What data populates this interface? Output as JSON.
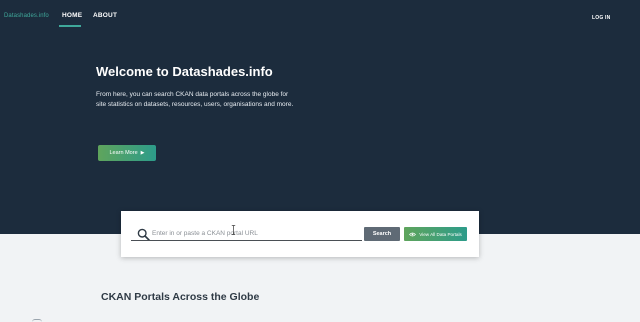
{
  "nav": {
    "logo": "Datashades.info",
    "home": "HOME",
    "about": "ABOUT",
    "login": "LOG IN"
  },
  "hero": {
    "title": "Welcome to Datashades.info",
    "description": "From here, you can search CKAN data portals across the globe for site statistics on datasets, resources, users, organisations and more.",
    "learn_more": "Learn More"
  },
  "search": {
    "placeholder": "Enter in or paste a CKAN portal URL",
    "search_label": "Search",
    "view_all_label": "View All Data Portals"
  },
  "section": {
    "title": "CKAN Portals Across the Globe"
  },
  "colors": {
    "hero_bg": "#1c2c3d",
    "accent": "#3fa89a",
    "button_green_start": "#5fa45c",
    "button_green_end": "#2d9c8a",
    "search_button": "#5f6a75",
    "page_bg": "#f1f3f5"
  },
  "icons": {
    "search": "search-icon",
    "learn_more": "caret-right-icon",
    "view_all": "eye-icon",
    "cursor": "text-cursor-icon"
  }
}
